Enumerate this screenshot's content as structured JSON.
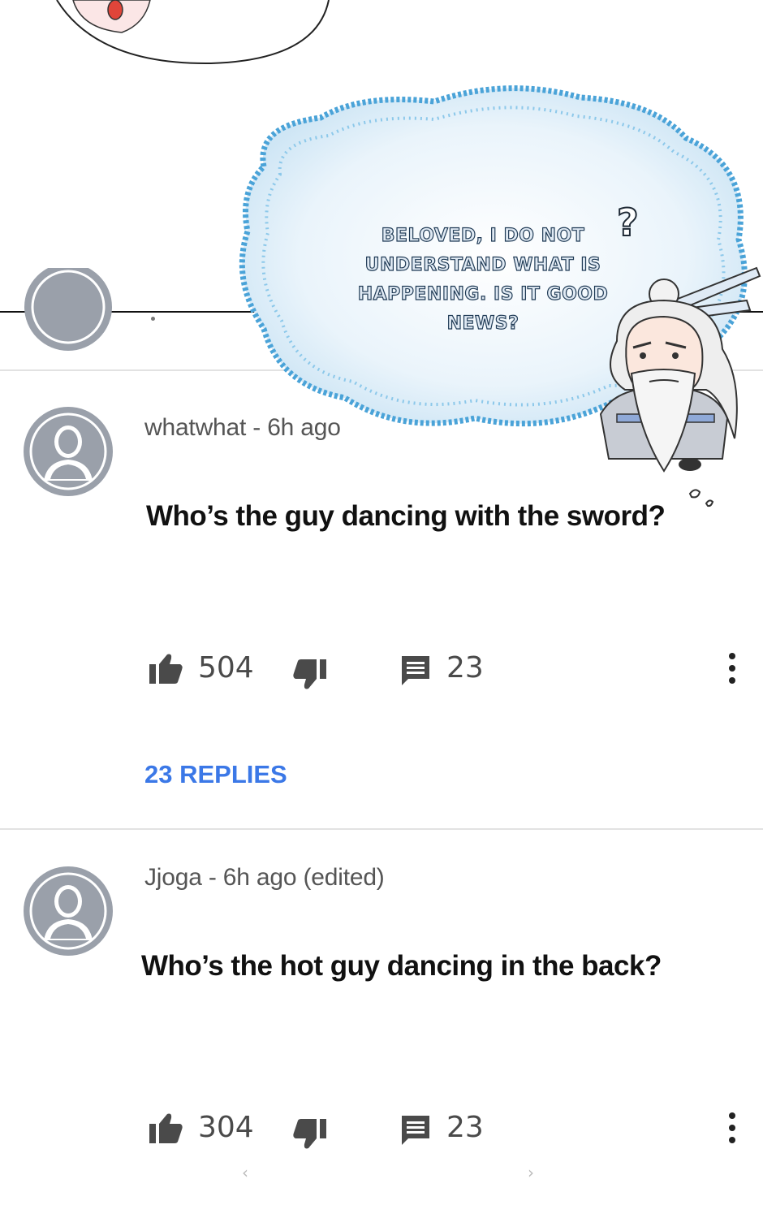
{
  "comic": {
    "bubble_text": "Beloved, I do not understand what is happening. Is it good news?",
    "question_mark": "?",
    "colors": {
      "bubble_fill": "#e9f3fa",
      "bubble_edge": "#4aa3d8",
      "outline": "#1f3a55"
    }
  },
  "comments": [
    {
      "author_line": "whatwhat - 6h ago",
      "text": "Who’s the guy dancing with the sword?",
      "likes": "504",
      "reply_count": "23",
      "replies_link": "23 REPLIES"
    },
    {
      "author_line": "Jjoga - 6h ago (edited)",
      "text": "Who’s the hot guy dancing in the back?",
      "likes": "304",
      "reply_count": "23"
    }
  ],
  "icons": {
    "like": "thumbs-up-icon",
    "dislike": "thumbs-down-icon",
    "reply": "comment-icon",
    "more": "more-vertical-icon",
    "avatar": "default-user-avatar-icon"
  },
  "colors": {
    "link": "#3b78e7",
    "avatar_gray": "#9aa0aa",
    "divider": "#e2e2e2"
  }
}
